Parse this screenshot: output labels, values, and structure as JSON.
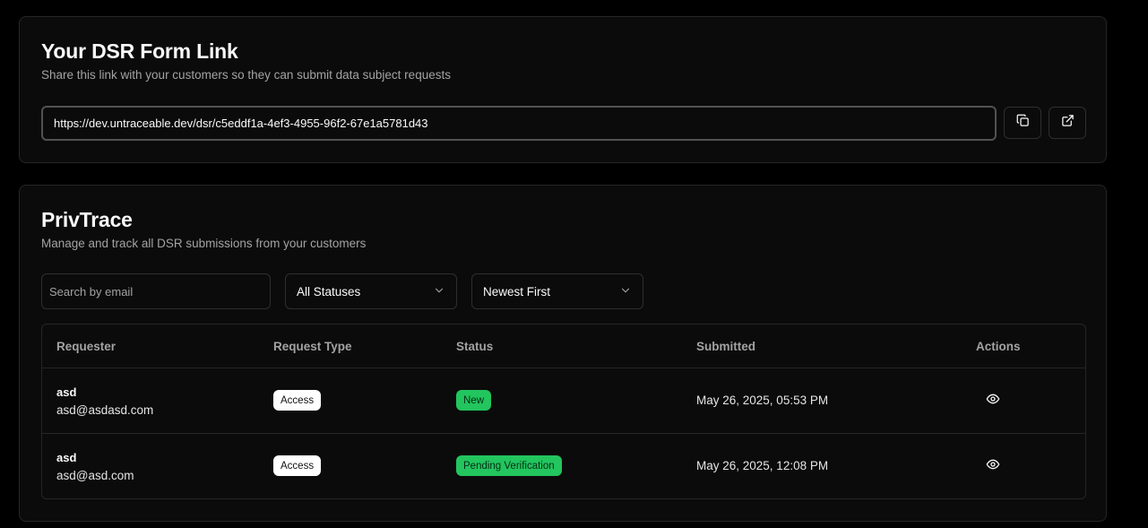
{
  "link_card": {
    "title": "Your DSR Form Link",
    "subtitle": "Share this link with your customers so they can submit data subject requests",
    "url": "https://dev.untraceable.dev/dsr/c5eddf1a-4ef3-4955-96f2-67e1a5781d43",
    "copy_icon": "copy-icon",
    "open_icon": "external-link-icon"
  },
  "privtrace": {
    "title": "PrivTrace",
    "subtitle": "Manage and track all DSR submissions from your customers",
    "search_placeholder": "Search by email",
    "status_filter": "All Statuses",
    "sort": "Newest First",
    "columns": [
      "Requester",
      "Request Type",
      "Status",
      "Submitted",
      "Actions"
    ],
    "rows": [
      {
        "name": "asd",
        "email": "asd@asdasd.com",
        "type": "Access",
        "status": "New",
        "submitted": "May 26, 2025, 05:53 PM"
      },
      {
        "name": "asd",
        "email": "asd@asd.com",
        "type": "Access",
        "status": "Pending Verification",
        "submitted": "May 26, 2025, 12:08 PM"
      }
    ]
  },
  "colors": {
    "background": "#000000",
    "card": "#0b0b0b",
    "border": "#262626",
    "status_green": "#22c55e"
  }
}
